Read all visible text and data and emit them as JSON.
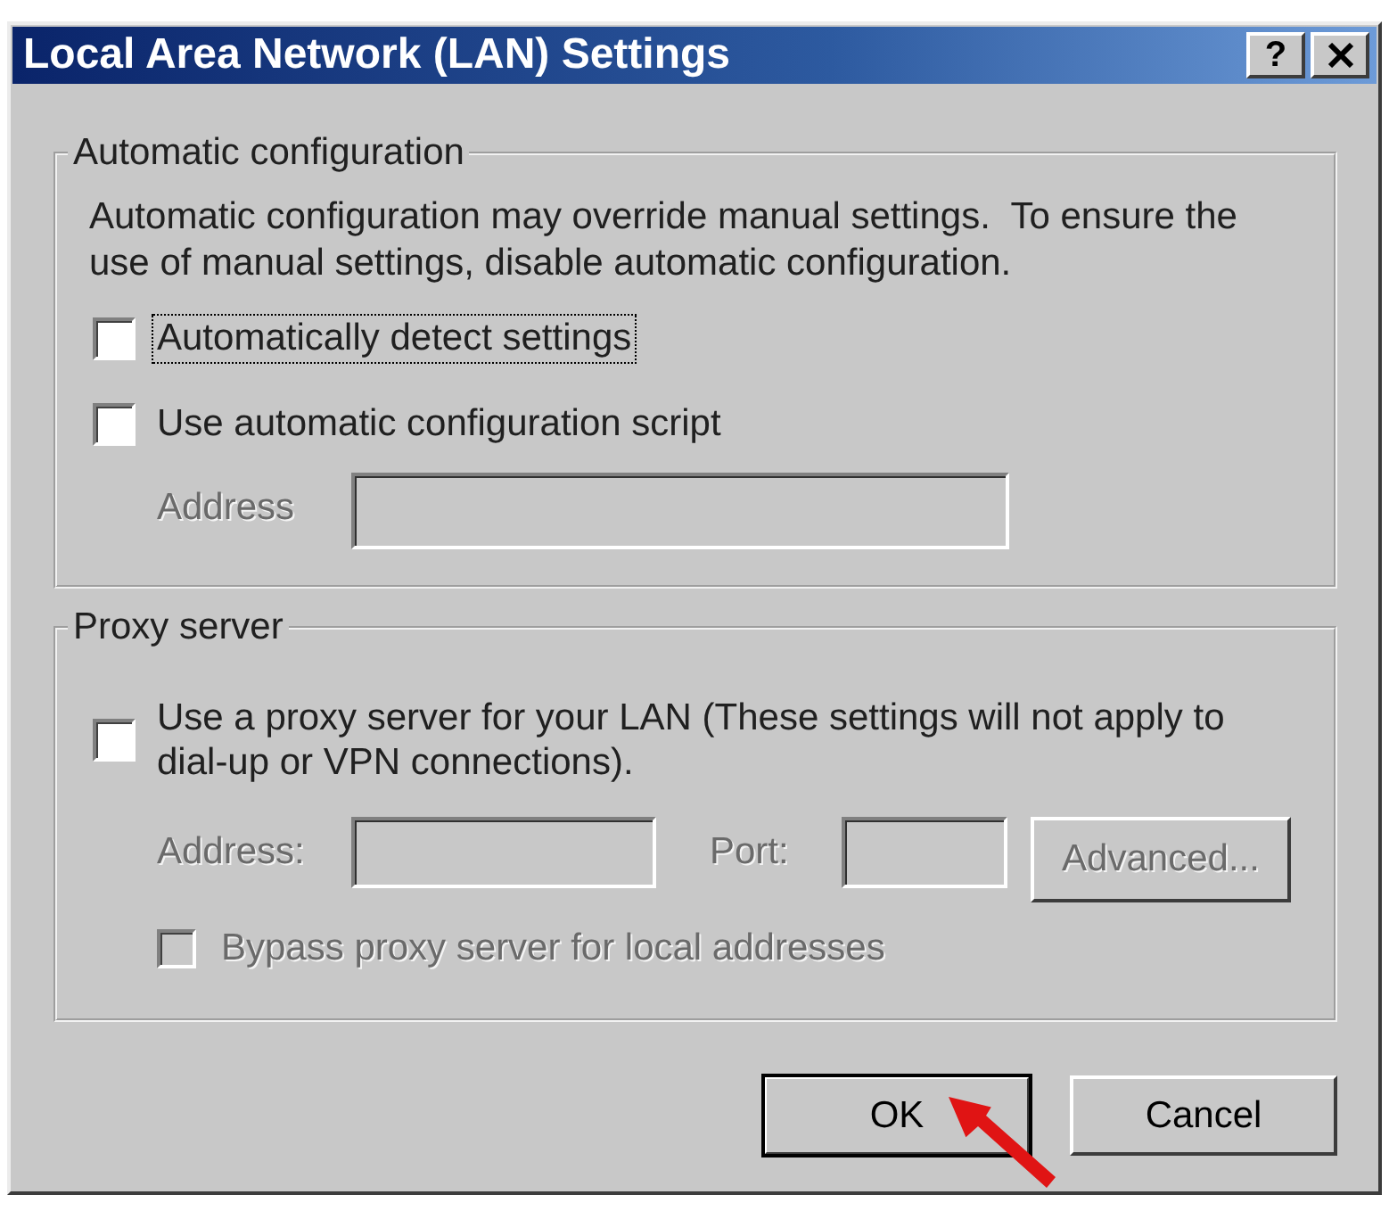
{
  "window": {
    "title": "Local Area Network (LAN) Settings",
    "buttons": [
      {
        "kind": "help",
        "label": "?"
      },
      {
        "kind": "close"
      }
    ]
  },
  "automatic_configuration": {
    "title": "Automatic configuration",
    "description": "Automatic configuration may override manual settings.  To ensure the use of manual settings, disable automatic configuration.",
    "options": [
      {
        "label": "Automatically detect settings",
        "checked": false,
        "focused": true,
        "disabled": false
      },
      {
        "label": "Use automatic configuration script",
        "checked": false,
        "focused": false,
        "disabled": false
      }
    ],
    "address": {
      "label": "Address",
      "disabled": true
    }
  },
  "proxy_server": {
    "title": "Proxy server",
    "use_proxy": {
      "label": "Use a proxy server for your LAN (These settings will not apply to dial-up or VPN connections).",
      "checked": false,
      "disabled": false
    },
    "address": {
      "label": "Address:",
      "disabled": true
    },
    "port": {
      "label": "Port:",
      "disabled": true
    },
    "advanced_button": {
      "label": "Advanced...",
      "disabled": true
    },
    "bypass": {
      "label": "Bypass proxy server for local addresses",
      "checked": false,
      "disabled": true
    }
  },
  "buttons": [
    {
      "label": "OK",
      "default": true
    },
    {
      "label": "Cancel",
      "default": false
    }
  ]
}
